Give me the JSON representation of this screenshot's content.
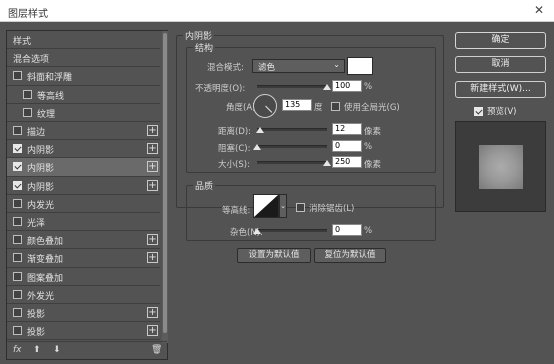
{
  "window": {
    "title": "图层样式",
    "close": "✕"
  },
  "styles_list": {
    "items": [
      {
        "label": "样式",
        "checkbox": false,
        "checked": false,
        "plus": false,
        "indent": 0,
        "selected": false
      },
      {
        "label": "混合选项",
        "checkbox": false,
        "checked": false,
        "plus": false,
        "indent": 0,
        "selected": false
      },
      {
        "label": "斜面和浮雕",
        "checkbox": true,
        "checked": false,
        "plus": false,
        "indent": 0,
        "selected": false
      },
      {
        "label": "等高线",
        "checkbox": true,
        "checked": false,
        "plus": false,
        "indent": 1,
        "selected": false
      },
      {
        "label": "纹理",
        "checkbox": true,
        "checked": false,
        "plus": false,
        "indent": 1,
        "selected": false
      },
      {
        "label": "描边",
        "checkbox": true,
        "checked": false,
        "plus": true,
        "indent": 0,
        "selected": false
      },
      {
        "label": "内阴影",
        "checkbox": true,
        "checked": true,
        "plus": true,
        "indent": 0,
        "selected": false
      },
      {
        "label": "内阴影",
        "checkbox": true,
        "checked": true,
        "plus": true,
        "indent": 0,
        "selected": true
      },
      {
        "label": "内阴影",
        "checkbox": true,
        "checked": true,
        "plus": true,
        "indent": 0,
        "selected": false
      },
      {
        "label": "内发光",
        "checkbox": true,
        "checked": false,
        "plus": false,
        "indent": 0,
        "selected": false
      },
      {
        "label": "光泽",
        "checkbox": true,
        "checked": false,
        "plus": false,
        "indent": 0,
        "selected": false
      },
      {
        "label": "颜色叠加",
        "checkbox": true,
        "checked": false,
        "plus": true,
        "indent": 0,
        "selected": false
      },
      {
        "label": "渐变叠加",
        "checkbox": true,
        "checked": false,
        "plus": true,
        "indent": 0,
        "selected": false
      },
      {
        "label": "图案叠加",
        "checkbox": true,
        "checked": false,
        "plus": false,
        "indent": 0,
        "selected": false
      },
      {
        "label": "外发光",
        "checkbox": true,
        "checked": false,
        "plus": false,
        "indent": 0,
        "selected": false
      },
      {
        "label": "投影",
        "checkbox": true,
        "checked": false,
        "plus": true,
        "indent": 0,
        "selected": false
      },
      {
        "label": "投影",
        "checkbox": true,
        "checked": false,
        "plus": true,
        "indent": 0,
        "selected": false
      }
    ],
    "footer": {
      "fx": "fx",
      "up": "⬆",
      "down": "⬇",
      "trash": "🗑"
    }
  },
  "inner_shadow": {
    "group_title": "内阴影",
    "structure": {
      "legend": "结构",
      "blend_mode_label": "混合模式:",
      "blend_mode_value": "滤色",
      "blend_color": "#ffffff",
      "opacity_label": "不透明度(O):",
      "opacity_value": "100",
      "opacity_unit": "%",
      "opacity_level": 1.0,
      "angle_label": "角度(A):",
      "angle_value": "135",
      "angle_unit": "度",
      "global_light_label": "使用全局光(G)",
      "global_light_checked": false,
      "distance_label": "距离(D):",
      "distance_value": "12",
      "distance_unit": "像素",
      "distance_level": 0.048,
      "choke_label": "阻塞(C):",
      "choke_value": "0",
      "choke_unit": "%",
      "choke_level": 0.0,
      "size_label": "大小(S):",
      "size_value": "250",
      "size_unit": "像素",
      "size_level": 1.0
    },
    "quality": {
      "legend": "品质",
      "contour_label": "等高线:",
      "antialias_label": "消除锯齿(L)",
      "antialias_checked": false,
      "noise_label": "杂色(N):",
      "noise_value": "0",
      "noise_unit": "%",
      "noise_level": 0.0
    },
    "make_default": "设置为默认值",
    "reset_default": "复位为默认值"
  },
  "actions": {
    "ok": "确定",
    "cancel": "取消",
    "new_style": "新建样式(W)...",
    "preview_label": "预览(V)",
    "preview_checked": true
  }
}
